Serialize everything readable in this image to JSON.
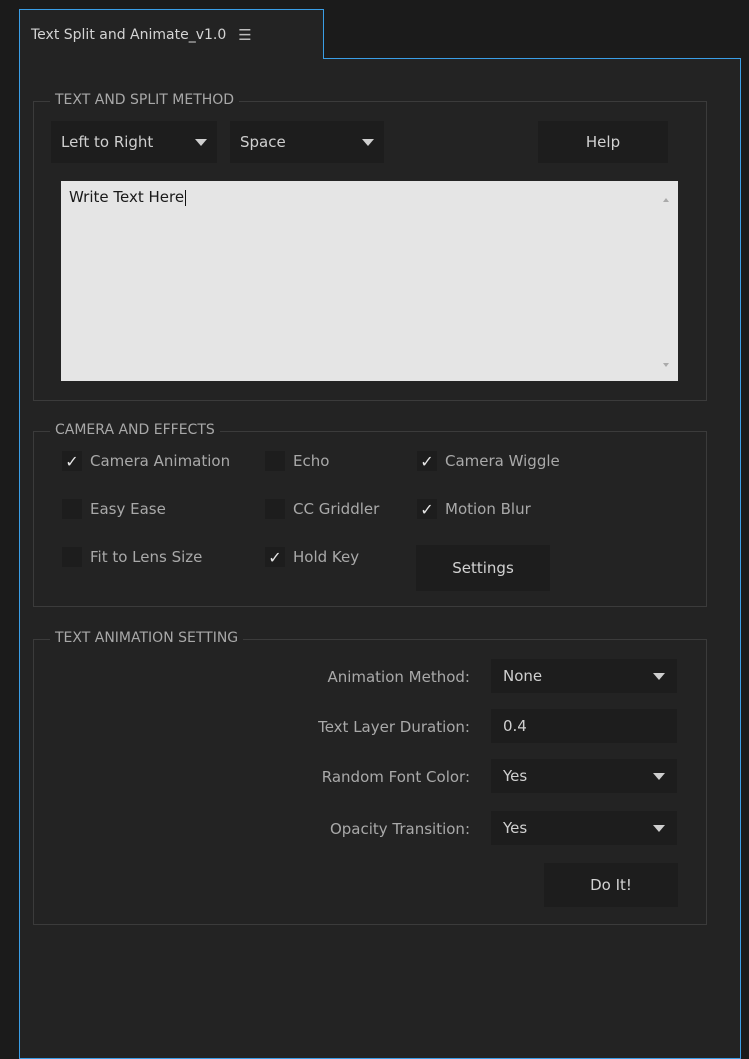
{
  "tab": {
    "title": "Text Split and Animate_v1.0",
    "menu_icon": "hamburger-icon"
  },
  "text_split": {
    "legend": "TEXT AND SPLIT METHOD",
    "direction": "Left to Right",
    "split_by": "Space",
    "help_label": "Help",
    "text_value": "Write Text Here"
  },
  "camera": {
    "legend": "CAMERA AND EFFECTS",
    "options": [
      {
        "label": "Camera Animation",
        "checked": true
      },
      {
        "label": "Echo",
        "checked": false
      },
      {
        "label": "Camera Wiggle",
        "checked": true
      },
      {
        "label": "Easy Ease",
        "checked": false
      },
      {
        "label": "CC Griddler",
        "checked": false
      },
      {
        "label": "Motion Blur",
        "checked": true
      },
      {
        "label": "Fit to Lens Size",
        "checked": false
      },
      {
        "label": "Hold Key",
        "checked": true
      }
    ],
    "settings_label": "Settings"
  },
  "anim": {
    "legend": "TEXT ANIMATION SETTING",
    "method_label": "Animation Method:",
    "method_value": "None",
    "duration_label": "Text Layer Duration:",
    "duration_value": "0.4",
    "color_label": "Random Font Color:",
    "color_value": "Yes",
    "opacity_label": "Opacity Transition:",
    "opacity_value": "Yes",
    "doit_label": "Do It!"
  },
  "check_mark": "✓"
}
